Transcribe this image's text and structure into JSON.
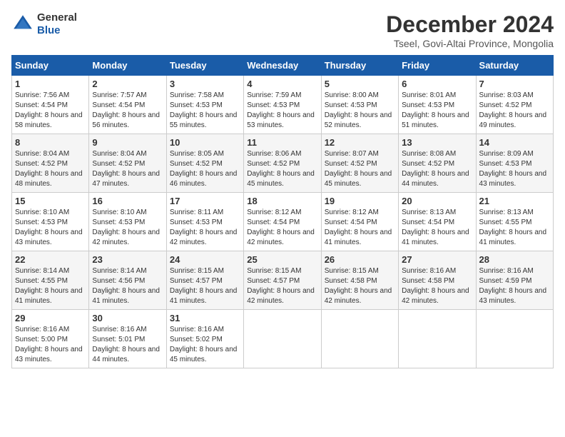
{
  "header": {
    "logo_line1": "General",
    "logo_line2": "Blue",
    "month_title": "December 2024",
    "subtitle": "Tseel, Govi-Altai Province, Mongolia"
  },
  "days_of_week": [
    "Sunday",
    "Monday",
    "Tuesday",
    "Wednesday",
    "Thursday",
    "Friday",
    "Saturday"
  ],
  "weeks": [
    [
      {
        "num": "1",
        "sunrise": "Sunrise: 7:56 AM",
        "sunset": "Sunset: 4:54 PM",
        "daylight": "Daylight: 8 hours and 58 minutes."
      },
      {
        "num": "2",
        "sunrise": "Sunrise: 7:57 AM",
        "sunset": "Sunset: 4:54 PM",
        "daylight": "Daylight: 8 hours and 56 minutes."
      },
      {
        "num": "3",
        "sunrise": "Sunrise: 7:58 AM",
        "sunset": "Sunset: 4:53 PM",
        "daylight": "Daylight: 8 hours and 55 minutes."
      },
      {
        "num": "4",
        "sunrise": "Sunrise: 7:59 AM",
        "sunset": "Sunset: 4:53 PM",
        "daylight": "Daylight: 8 hours and 53 minutes."
      },
      {
        "num": "5",
        "sunrise": "Sunrise: 8:00 AM",
        "sunset": "Sunset: 4:53 PM",
        "daylight": "Daylight: 8 hours and 52 minutes."
      },
      {
        "num": "6",
        "sunrise": "Sunrise: 8:01 AM",
        "sunset": "Sunset: 4:53 PM",
        "daylight": "Daylight: 8 hours and 51 minutes."
      },
      {
        "num": "7",
        "sunrise": "Sunrise: 8:03 AM",
        "sunset": "Sunset: 4:52 PM",
        "daylight": "Daylight: 8 hours and 49 minutes."
      }
    ],
    [
      {
        "num": "8",
        "sunrise": "Sunrise: 8:04 AM",
        "sunset": "Sunset: 4:52 PM",
        "daylight": "Daylight: 8 hours and 48 minutes."
      },
      {
        "num": "9",
        "sunrise": "Sunrise: 8:04 AM",
        "sunset": "Sunset: 4:52 PM",
        "daylight": "Daylight: 8 hours and 47 minutes."
      },
      {
        "num": "10",
        "sunrise": "Sunrise: 8:05 AM",
        "sunset": "Sunset: 4:52 PM",
        "daylight": "Daylight: 8 hours and 46 minutes."
      },
      {
        "num": "11",
        "sunrise": "Sunrise: 8:06 AM",
        "sunset": "Sunset: 4:52 PM",
        "daylight": "Daylight: 8 hours and 45 minutes."
      },
      {
        "num": "12",
        "sunrise": "Sunrise: 8:07 AM",
        "sunset": "Sunset: 4:52 PM",
        "daylight": "Daylight: 8 hours and 45 minutes."
      },
      {
        "num": "13",
        "sunrise": "Sunrise: 8:08 AM",
        "sunset": "Sunset: 4:52 PM",
        "daylight": "Daylight: 8 hours and 44 minutes."
      },
      {
        "num": "14",
        "sunrise": "Sunrise: 8:09 AM",
        "sunset": "Sunset: 4:53 PM",
        "daylight": "Daylight: 8 hours and 43 minutes."
      }
    ],
    [
      {
        "num": "15",
        "sunrise": "Sunrise: 8:10 AM",
        "sunset": "Sunset: 4:53 PM",
        "daylight": "Daylight: 8 hours and 43 minutes."
      },
      {
        "num": "16",
        "sunrise": "Sunrise: 8:10 AM",
        "sunset": "Sunset: 4:53 PM",
        "daylight": "Daylight: 8 hours and 42 minutes."
      },
      {
        "num": "17",
        "sunrise": "Sunrise: 8:11 AM",
        "sunset": "Sunset: 4:53 PM",
        "daylight": "Daylight: 8 hours and 42 minutes."
      },
      {
        "num": "18",
        "sunrise": "Sunrise: 8:12 AM",
        "sunset": "Sunset: 4:54 PM",
        "daylight": "Daylight: 8 hours and 42 minutes."
      },
      {
        "num": "19",
        "sunrise": "Sunrise: 8:12 AM",
        "sunset": "Sunset: 4:54 PM",
        "daylight": "Daylight: 8 hours and 41 minutes."
      },
      {
        "num": "20",
        "sunrise": "Sunrise: 8:13 AM",
        "sunset": "Sunset: 4:54 PM",
        "daylight": "Daylight: 8 hours and 41 minutes."
      },
      {
        "num": "21",
        "sunrise": "Sunrise: 8:13 AM",
        "sunset": "Sunset: 4:55 PM",
        "daylight": "Daylight: 8 hours and 41 minutes."
      }
    ],
    [
      {
        "num": "22",
        "sunrise": "Sunrise: 8:14 AM",
        "sunset": "Sunset: 4:55 PM",
        "daylight": "Daylight: 8 hours and 41 minutes."
      },
      {
        "num": "23",
        "sunrise": "Sunrise: 8:14 AM",
        "sunset": "Sunset: 4:56 PM",
        "daylight": "Daylight: 8 hours and 41 minutes."
      },
      {
        "num": "24",
        "sunrise": "Sunrise: 8:15 AM",
        "sunset": "Sunset: 4:57 PM",
        "daylight": "Daylight: 8 hours and 41 minutes."
      },
      {
        "num": "25",
        "sunrise": "Sunrise: 8:15 AM",
        "sunset": "Sunset: 4:57 PM",
        "daylight": "Daylight: 8 hours and 42 minutes."
      },
      {
        "num": "26",
        "sunrise": "Sunrise: 8:15 AM",
        "sunset": "Sunset: 4:58 PM",
        "daylight": "Daylight: 8 hours and 42 minutes."
      },
      {
        "num": "27",
        "sunrise": "Sunrise: 8:16 AM",
        "sunset": "Sunset: 4:58 PM",
        "daylight": "Daylight: 8 hours and 42 minutes."
      },
      {
        "num": "28",
        "sunrise": "Sunrise: 8:16 AM",
        "sunset": "Sunset: 4:59 PM",
        "daylight": "Daylight: 8 hours and 43 minutes."
      }
    ],
    [
      {
        "num": "29",
        "sunrise": "Sunrise: 8:16 AM",
        "sunset": "Sunset: 5:00 PM",
        "daylight": "Daylight: 8 hours and 43 minutes."
      },
      {
        "num": "30",
        "sunrise": "Sunrise: 8:16 AM",
        "sunset": "Sunset: 5:01 PM",
        "daylight": "Daylight: 8 hours and 44 minutes."
      },
      {
        "num": "31",
        "sunrise": "Sunrise: 8:16 AM",
        "sunset": "Sunset: 5:02 PM",
        "daylight": "Daylight: 8 hours and 45 minutes."
      },
      null,
      null,
      null,
      null
    ]
  ]
}
